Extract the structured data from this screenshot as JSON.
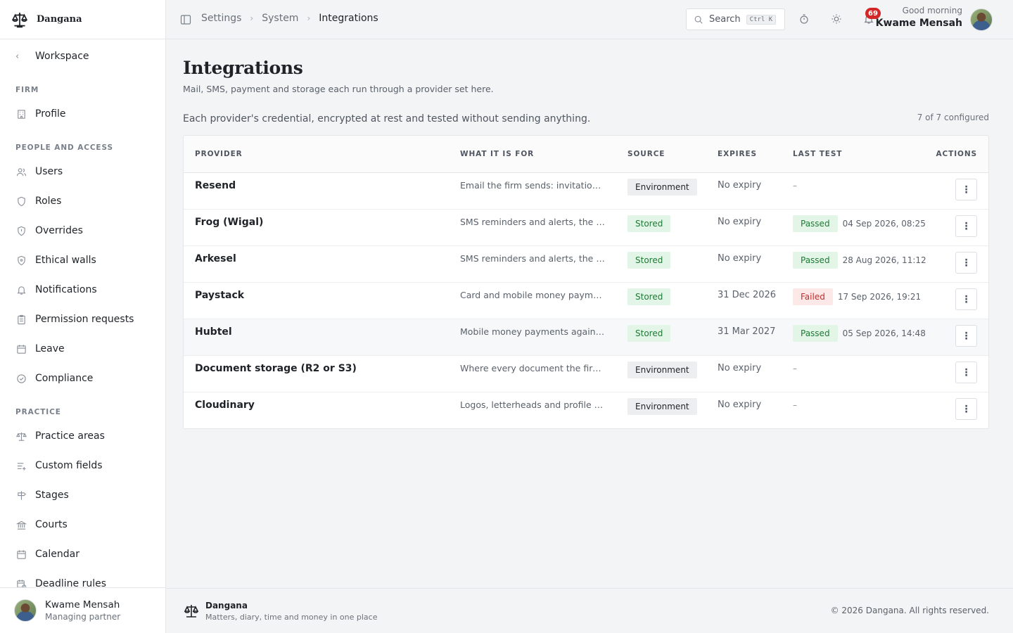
{
  "app": {
    "name": "Dangana",
    "tagline": "Matters, diary, time and money in one place",
    "copyright": "© 2026 Dangana. All rights reserved."
  },
  "sidebar": {
    "back_label": "Workspace",
    "sections": [
      {
        "title": "FIRM",
        "items": [
          {
            "label": "Profile",
            "icon": "building-icon"
          }
        ]
      },
      {
        "title": "PEOPLE AND ACCESS",
        "items": [
          {
            "label": "Users",
            "icon": "users-icon"
          },
          {
            "label": "Roles",
            "icon": "shield-icon"
          },
          {
            "label": "Overrides",
            "icon": "shield-alert-icon"
          },
          {
            "label": "Ethical walls",
            "icon": "shield-lock-icon"
          },
          {
            "label": "Notifications",
            "icon": "bell-icon"
          },
          {
            "label": "Permission requests",
            "icon": "clipboard-icon"
          },
          {
            "label": "Leave",
            "icon": "calendar-icon"
          },
          {
            "label": "Compliance",
            "icon": "check-circle-icon"
          }
        ]
      },
      {
        "title": "PRACTICE",
        "items": [
          {
            "label": "Practice areas",
            "icon": "scales-icon"
          },
          {
            "label": "Custom fields",
            "icon": "list-plus-icon"
          },
          {
            "label": "Stages",
            "icon": "signpost-icon"
          },
          {
            "label": "Courts",
            "icon": "landmark-icon"
          },
          {
            "label": "Calendar",
            "icon": "calendar-icon"
          },
          {
            "label": "Deadline rules",
            "icon": "calendar-clock-icon"
          }
        ]
      }
    ],
    "user": {
      "name": "Kwame Mensah",
      "role": "Managing partner"
    }
  },
  "topbar": {
    "breadcrumbs": [
      "Settings",
      "System",
      "Integrations"
    ],
    "search": {
      "label": "Search",
      "shortcut": "Ctrl K"
    },
    "notification_count": "69",
    "greeting": "Good morning",
    "user_name": "Kwame Mensah"
  },
  "page": {
    "title": "Integrations",
    "subtitle": "Mail, SMS, payment and storage each run through a provider set here.",
    "section_description": "Each provider's credential, encrypted at rest and tested without sending anything.",
    "configured_count": "7 of 7 configured"
  },
  "table": {
    "columns": [
      "PROVIDER",
      "WHAT IT IS FOR",
      "SOURCE",
      "EXPIRES",
      "LAST TEST",
      "ACTIONS"
    ],
    "rows": [
      {
        "provider": "Resend",
        "purpose": "Email the firm sends: invitations…",
        "source": "Environment",
        "expires": "No expiry",
        "test_status": "",
        "test_time": "–"
      },
      {
        "provider": "Frog (Wigal)",
        "purpose": "SMS reminders and alerts, the fi…",
        "source": "Stored",
        "expires": "No expiry",
        "test_status": "Passed",
        "test_time": "04 Sep 2026, 08:25"
      },
      {
        "provider": "Arkesel",
        "purpose": "SMS reminders and alerts, the s…",
        "source": "Stored",
        "expires": "No expiry",
        "test_status": "Passed",
        "test_time": "28 Aug 2026, 11:12"
      },
      {
        "provider": "Paystack",
        "purpose": "Card and mobile money payme…",
        "source": "Stored",
        "expires": "31 Dec 2026",
        "test_status": "Failed",
        "test_time": "17 Sep 2026, 19:21"
      },
      {
        "provider": "Hubtel",
        "purpose": "Mobile money payments agains…",
        "source": "Stored",
        "expires": "31 Mar 2027",
        "test_status": "Passed",
        "test_time": "05 Sep 2026, 14:48"
      },
      {
        "provider": "Document storage (R2 or S3)",
        "purpose": "Where every document the firm…",
        "source": "Environment",
        "expires": "No expiry",
        "test_status": "",
        "test_time": "–"
      },
      {
        "provider": "Cloudinary",
        "purpose": "Logos, letterheads and profile p…",
        "source": "Environment",
        "expires": "No expiry",
        "test_status": "",
        "test_time": "–"
      }
    ],
    "actions_glyph": "⋮"
  },
  "colors": {
    "accent_green": "#1e7a36",
    "danger_red": "#c42b2b",
    "badge_red": "#d32626"
  }
}
